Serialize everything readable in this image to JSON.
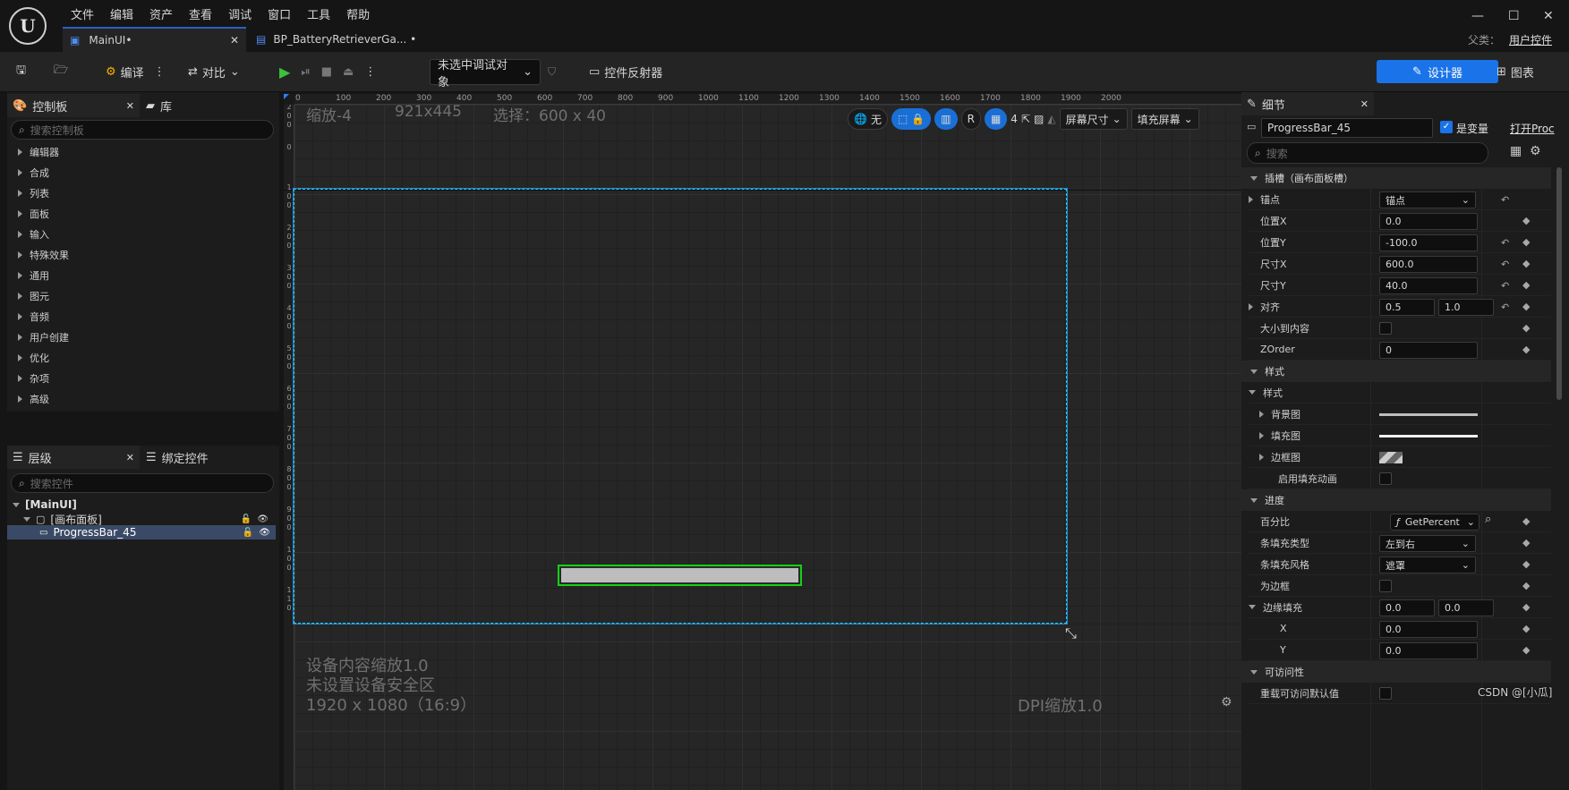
{
  "menu": [
    "文件",
    "编辑",
    "资产",
    "查看",
    "调试",
    "窗口",
    "工具",
    "帮助"
  ],
  "tabs": [
    {
      "label": "MainUI•"
    },
    {
      "label": "BP_BatteryRetrieverGa... •"
    }
  ],
  "parent_label": "父类：",
  "parent_value": "用户控件",
  "toolbar": {
    "compile": "编译",
    "diff": "对比",
    "debug_target": "未选中调试对象",
    "reflector": "控件反射器",
    "designer": "设计器",
    "graph": "图表"
  },
  "palette": {
    "tab_label": "控制板",
    "lib_label": "库",
    "search_placeholder": "搜索控制板",
    "categories": [
      "编辑器",
      "合成",
      "列表",
      "面板",
      "输入",
      "特殊效果",
      "通用",
      "图元",
      "音频",
      "用户创建",
      "优化",
      "杂项",
      "高级"
    ]
  },
  "hierarchy": {
    "tab_label": "层级",
    "bind_label": "绑定控件",
    "search_placeholder": "搜索控件",
    "root": "[MainUI]",
    "canvas": "[画布面板]",
    "item": "ProgressBar_45"
  },
  "viewport": {
    "zoom": "缩放-4",
    "res": "921x445",
    "selection": "选择：600 x 40",
    "chip_none": "无",
    "chip_r": "R",
    "grid_num": "4",
    "screen_size": "屏幕尺寸",
    "fill_screen": "填充屏幕",
    "device_scale": "设备内容缩放1.0",
    "no_safe_zone": "未设置设备安全区",
    "resolution": "1920 x 1080（16:9）",
    "dpi": "DPI缩放1.0",
    "ruler_h": [
      "0",
      "100",
      "200",
      "300",
      "400",
      "500",
      "600",
      "700",
      "800",
      "900",
      "1000",
      "1100",
      "1200",
      "1300",
      "1400",
      "1500",
      "1600",
      "1700",
      "1800",
      "1900",
      "2000"
    ],
    "ruler_v": [
      "2\n0\n0",
      "0",
      "1\n0\n0",
      "2\n0\n0",
      "3\n0\n0",
      "4\n0\n0",
      "5\n0\n0",
      "6\n0\n0",
      "7\n0\n0",
      "8\n0\n0",
      "9\n0\n0",
      "1\n0\n0",
      "1\n1\n0"
    ]
  },
  "details": {
    "tab_label": "细节",
    "name": "ProgressBar_45",
    "is_var": "是变量",
    "open": "打开Proc",
    "search_placeholder": "搜索",
    "slot_section": "插槽（画布面板槽）",
    "anchor_label": "锚点",
    "anchor_value": "锚点",
    "posx_label": "位置X",
    "posx": "0.0",
    "posy_label": "位置Y",
    "posy": "-100.0",
    "sizex_label": "尺寸X",
    "sizex": "600.0",
    "sizey_label": "尺寸Y",
    "sizey": "40.0",
    "align_label": "对齐",
    "align_x": "0.5",
    "align_y": "1.0",
    "autosize_label": "大小到内容",
    "zorder_label": "ZOrder",
    "zorder": "0",
    "style_section": "样式",
    "style_sub": "样式",
    "bg_label": "背景图",
    "fill_label": "填充图",
    "border_label": "边框图",
    "anim_label": "启用填充动画",
    "progress_section": "进度",
    "percent_label": "百分比",
    "percent_value": "GetPercent",
    "filltype_label": "条填充类型",
    "filltype_value": "左到右",
    "fillstyle_label": "条填充风格",
    "fillstyle_value": "遮罩",
    "marquee_label": "为边框",
    "pad_label": "边缘填充",
    "pad_x": "0.0",
    "pad_y": "0.0",
    "x_label": "X",
    "x_value": "0.0",
    "y_label": "Y",
    "y_value": "0.0",
    "access_section": "可访问性",
    "override_label": "重载可访问默认值"
  },
  "watermark": "CSDN @[小瓜]"
}
